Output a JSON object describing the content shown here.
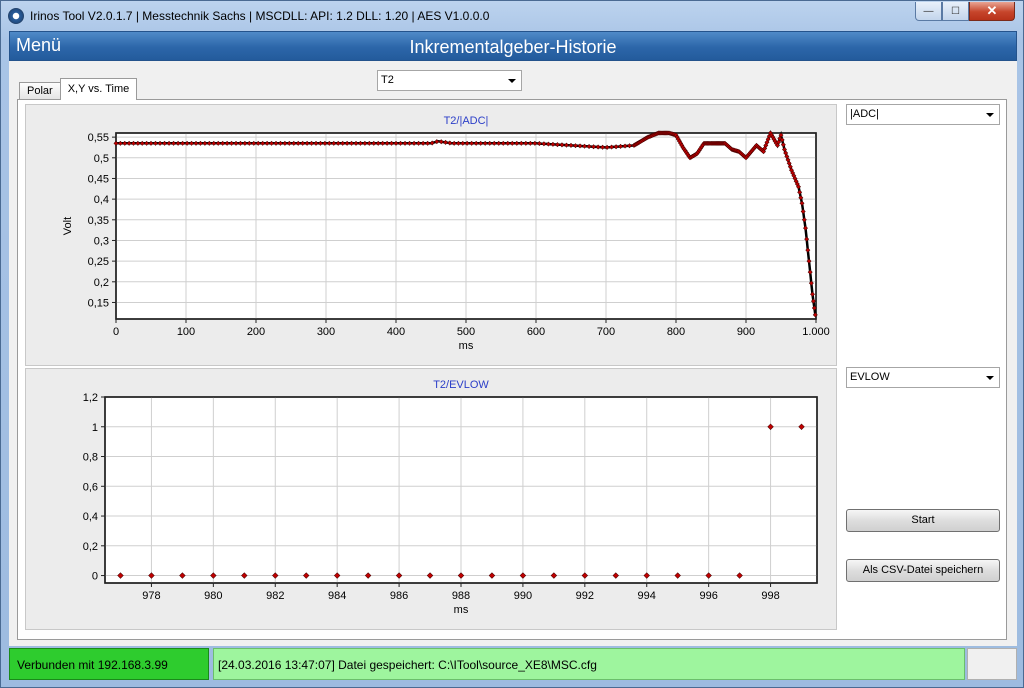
{
  "window": {
    "title": "Irinos Tool V2.0.1.7 | Messtechnik Sachs | MSCDLL: API: 1.2 DLL: 1.20 | AES V1.0.0.0",
    "minimize_glyph": "—",
    "maximize_glyph": "☐",
    "close_glyph": "✕"
  },
  "header": {
    "menu_label": "Menü",
    "title": "Inkrementalgeber-Historie"
  },
  "tabs": [
    {
      "label": "Polar"
    },
    {
      "label": "X,Y vs. Time"
    }
  ],
  "active_tab": 1,
  "channel_select": {
    "value": "T2"
  },
  "right_panel": {
    "top_select": {
      "value": "|ADC|"
    },
    "bottom_select": {
      "value": "EVLOW"
    },
    "start_button": "Start",
    "csv_button": "Als CSV-Datei speichern"
  },
  "status": {
    "connection": "Verbunden mit 192.168.3.99",
    "message": "[24.03.2016 13:47:07] Datei gespeichert: C:\\ITool\\source_XE8\\MSC.cfg",
    "connection_color": "#2ecc2e",
    "message_color": "#9ef59e"
  },
  "chart_data": [
    {
      "type": "scatter",
      "title": "T2/|ADC|",
      "xlabel": "ms",
      "ylabel": "Volt",
      "xlim": [
        0,
        1000
      ],
      "ylim": [
        0.11,
        0.56
      ],
      "xticks": [
        0,
        100,
        200,
        300,
        400,
        500,
        600,
        700,
        800,
        900,
        1000
      ],
      "xtick_labels": [
        "0",
        "100",
        "200",
        "300",
        "400",
        "500",
        "600",
        "700",
        "800",
        "900",
        "1.000"
      ],
      "yticks": [
        0.15,
        0.2,
        0.25,
        0.3,
        0.35,
        0.4,
        0.45,
        0.5,
        0.55
      ],
      "ytick_labels": [
        "0,15",
        "0,2",
        "0,25",
        "0,3",
        "0,35",
        "0,4",
        "0,45",
        "0,5",
        "0,55"
      ],
      "grid": true,
      "marker_color": "#c00000",
      "line_color": "#000000",
      "series": [
        {
          "x": [
            0,
            25,
            50,
            100,
            200,
            300,
            400,
            450,
            460,
            480,
            500,
            550,
            600,
            650,
            700,
            740,
            760,
            775,
            790,
            800,
            810,
            820,
            830,
            840,
            850,
            870,
            880,
            890,
            900,
            905,
            915,
            925,
            935,
            945,
            950,
            955,
            960,
            965,
            970,
            975,
            980,
            985,
            990,
            995,
            999
          ],
          "y": [
            0.535,
            0.535,
            0.535,
            0.535,
            0.535,
            0.535,
            0.535,
            0.535,
            0.54,
            0.535,
            0.535,
            0.535,
            0.535,
            0.53,
            0.525,
            0.53,
            0.55,
            0.56,
            0.56,
            0.555,
            0.525,
            0.5,
            0.51,
            0.535,
            0.535,
            0.535,
            0.52,
            0.515,
            0.5,
            0.51,
            0.53,
            0.515,
            0.56,
            0.53,
            0.555,
            0.52,
            0.495,
            0.47,
            0.45,
            0.43,
            0.39,
            0.33,
            0.25,
            0.17,
            0.12
          ]
        }
      ]
    },
    {
      "type": "scatter",
      "title": "T2/EVLOW",
      "xlabel": "ms",
      "ylabel": "",
      "xlim": [
        976.5,
        999.5
      ],
      "ylim": [
        -0.05,
        1.2
      ],
      "xticks": [
        978,
        980,
        982,
        984,
        986,
        988,
        990,
        992,
        994,
        996,
        998
      ],
      "xtick_labels": [
        "978",
        "980",
        "982",
        "984",
        "986",
        "988",
        "990",
        "992",
        "994",
        "996",
        "998"
      ],
      "yticks": [
        0,
        0.2,
        0.4,
        0.6,
        0.8,
        1,
        1.2
      ],
      "ytick_labels": [
        "0",
        "0,2",
        "0,4",
        "0,6",
        "0,8",
        "1",
        "1,2"
      ],
      "grid": true,
      "marker_color": "#c00000",
      "series": [
        {
          "x": [
            977,
            978,
            979,
            980,
            981,
            982,
            983,
            984,
            985,
            986,
            987,
            988,
            989,
            990,
            991,
            992,
            993,
            994,
            995,
            996,
            997,
            998,
            999
          ],
          "y": [
            0,
            0,
            0,
            0,
            0,
            0,
            0,
            0,
            0,
            0,
            0,
            0,
            0,
            0,
            0,
            0,
            0,
            0,
            0,
            0,
            0,
            1,
            1
          ]
        }
      ]
    }
  ]
}
